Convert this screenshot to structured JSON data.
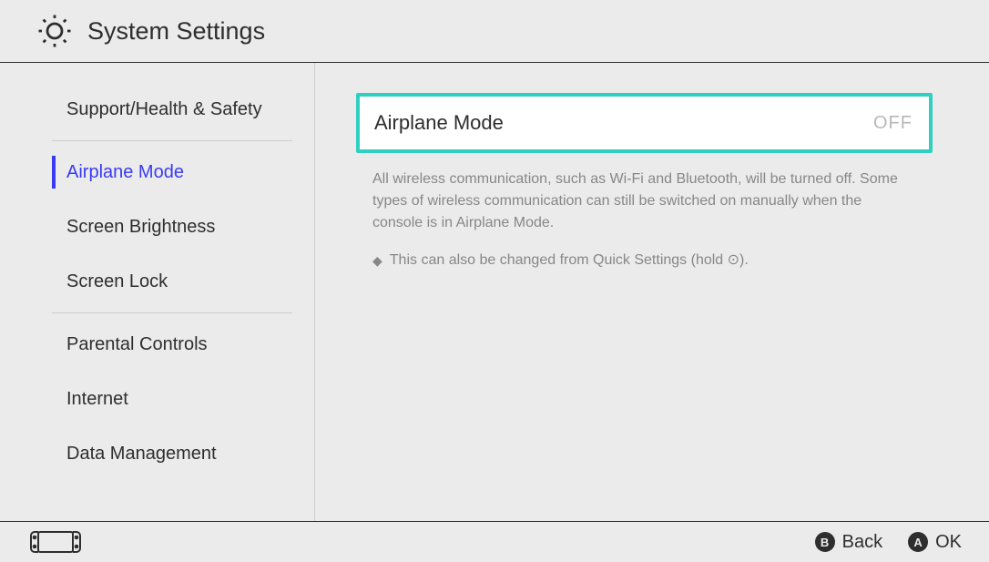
{
  "header": {
    "title": "System Settings"
  },
  "sidebar": {
    "groups": [
      {
        "items": [
          {
            "label": "Support/Health & Safety",
            "selected": false
          }
        ]
      },
      {
        "items": [
          {
            "label": "Airplane Mode",
            "selected": true
          },
          {
            "label": "Screen Brightness",
            "selected": false
          },
          {
            "label": "Screen Lock",
            "selected": false
          }
        ]
      },
      {
        "items": [
          {
            "label": "Parental Controls",
            "selected": false
          },
          {
            "label": "Internet",
            "selected": false
          },
          {
            "label": "Data Management",
            "selected": false
          }
        ]
      }
    ]
  },
  "main": {
    "setting": {
      "label": "Airplane Mode",
      "value": "OFF"
    },
    "description": {
      "text": "All wireless communication, such as Wi-Fi and Bluetooth, will be turned off. Some types of wireless communication can still be switched on manually when the console is in Airplane Mode.",
      "note": "This can also be changed from Quick Settings (hold ⊙)."
    }
  },
  "footer": {
    "buttons": [
      {
        "icon": "B",
        "label": "Back"
      },
      {
        "icon": "A",
        "label": "OK"
      }
    ]
  }
}
